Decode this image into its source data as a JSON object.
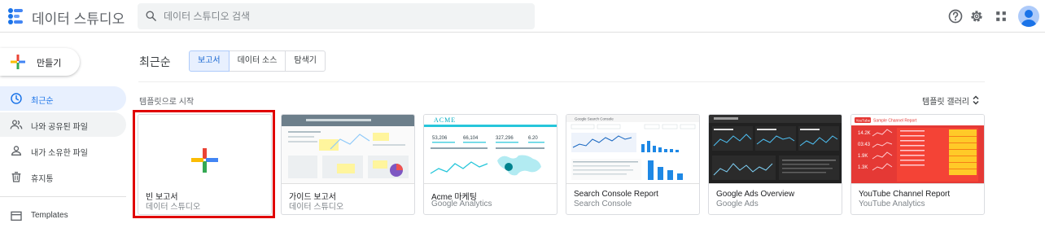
{
  "app": {
    "title": "데이터 스튜디오"
  },
  "search": {
    "placeholder": "데이터 스튜디오 검색"
  },
  "create": {
    "label": "만들기"
  },
  "nav": [
    {
      "label": "최근순"
    },
    {
      "label": "나와 공유된 파일"
    },
    {
      "label": "내가 소유한 파일"
    },
    {
      "label": "휴지통"
    },
    {
      "label": "Templates"
    }
  ],
  "main": {
    "title": "최근순",
    "tabs": [
      {
        "label": "보고서"
      },
      {
        "label": "데이터 소스"
      },
      {
        "label": "탐색기"
      }
    ],
    "template_section": "템플릿으로 시작",
    "gallery_label": "템플릿 갤러리"
  },
  "cards": [
    {
      "name": "빈 보고서",
      "source": "데이터 스튜디오"
    },
    {
      "name": "가이드 보고서",
      "source": "데이터 스튜디오"
    },
    {
      "name": "Acme 마케팅",
      "source": "Google Analytics"
    },
    {
      "name": "Search Console Report",
      "source": "Search Console"
    },
    {
      "name": "Google Ads Overview",
      "source": "Google Ads"
    },
    {
      "name": "YouTube Channel Report",
      "source": "YouTube Analytics"
    }
  ],
  "thumbs": {
    "acme_logo": "ACME",
    "acme_stats": [
      "53,206",
      "66,104",
      "327,296",
      "6.20"
    ],
    "sc_title": "Google Search Console",
    "yt_logo": "YouTube",
    "yt_title": "Sample Channel Report",
    "yt_stats": [
      "14.2K",
      "03:43",
      "1.9K",
      "1.3K"
    ]
  },
  "colors": {
    "accent": "#1a73e8",
    "highlight": "#e00000"
  }
}
